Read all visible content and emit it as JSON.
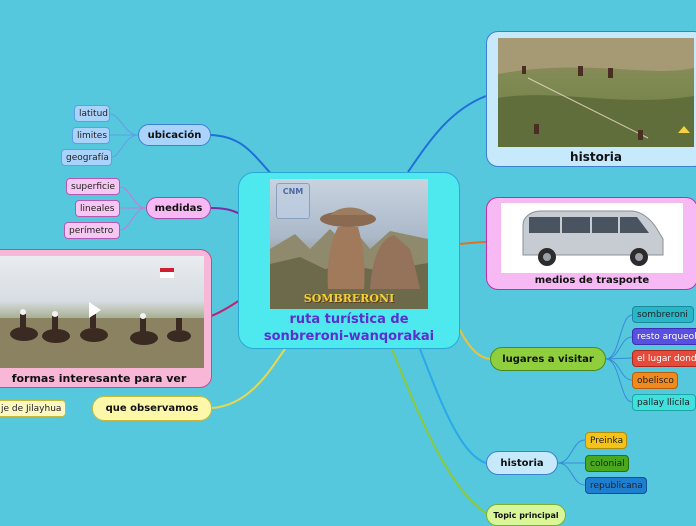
{
  "central": {
    "title_line1": "ruta turística de",
    "title_line2": "sonbreroni-wanqorakai",
    "image_caption": "SOMBRERONI",
    "logo_text": "CNM"
  },
  "left_branches": {
    "ubicacion": {
      "label": "ubicación",
      "items": [
        "latitud",
        "limites",
        "geografía"
      ]
    },
    "medidas": {
      "label": "medidas",
      "items": [
        "superficie",
        "lineales",
        "perímetro"
      ]
    },
    "formas": {
      "label": "formas interesante para ver"
    },
    "observamos": {
      "label": "que observamos",
      "items": [
        "je de Jilayhua"
      ]
    }
  },
  "right_branches": {
    "historia_card": {
      "label": "historia"
    },
    "transporte": {
      "label": "medios de trasporte"
    },
    "lugares": {
      "label": "lugares a visitar",
      "items": [
        "sombreroni",
        "resto arqueol",
        "el lugar dond",
        "obelisco",
        "pallay llicila"
      ]
    },
    "historia": {
      "label": "historia",
      "items": [
        "Preinka",
        "colonial",
        "republicana"
      ]
    },
    "topic": {
      "label": "Topic principal"
    }
  },
  "colors": {
    "background": "#56c8de",
    "central": "#4ee9ef",
    "ubicacion": "#a9d3fb",
    "medidas": "#f7b9f4",
    "formas": "#f9b7d8",
    "observamos": "#fdf7a9",
    "lugares": "#8fcf3e",
    "historia": "#c6e9fb",
    "topic": "#d9f79a",
    "sombreroni": "#27b7c9",
    "resto": "#5a4fe0",
    "el_lugar": "#e54a3a",
    "obelisco": "#f08a1e",
    "pallay": "#3fe0dd",
    "preinka": "#f5c21a",
    "colonial": "#4aa81f",
    "republicana": "#1e7fd1"
  }
}
